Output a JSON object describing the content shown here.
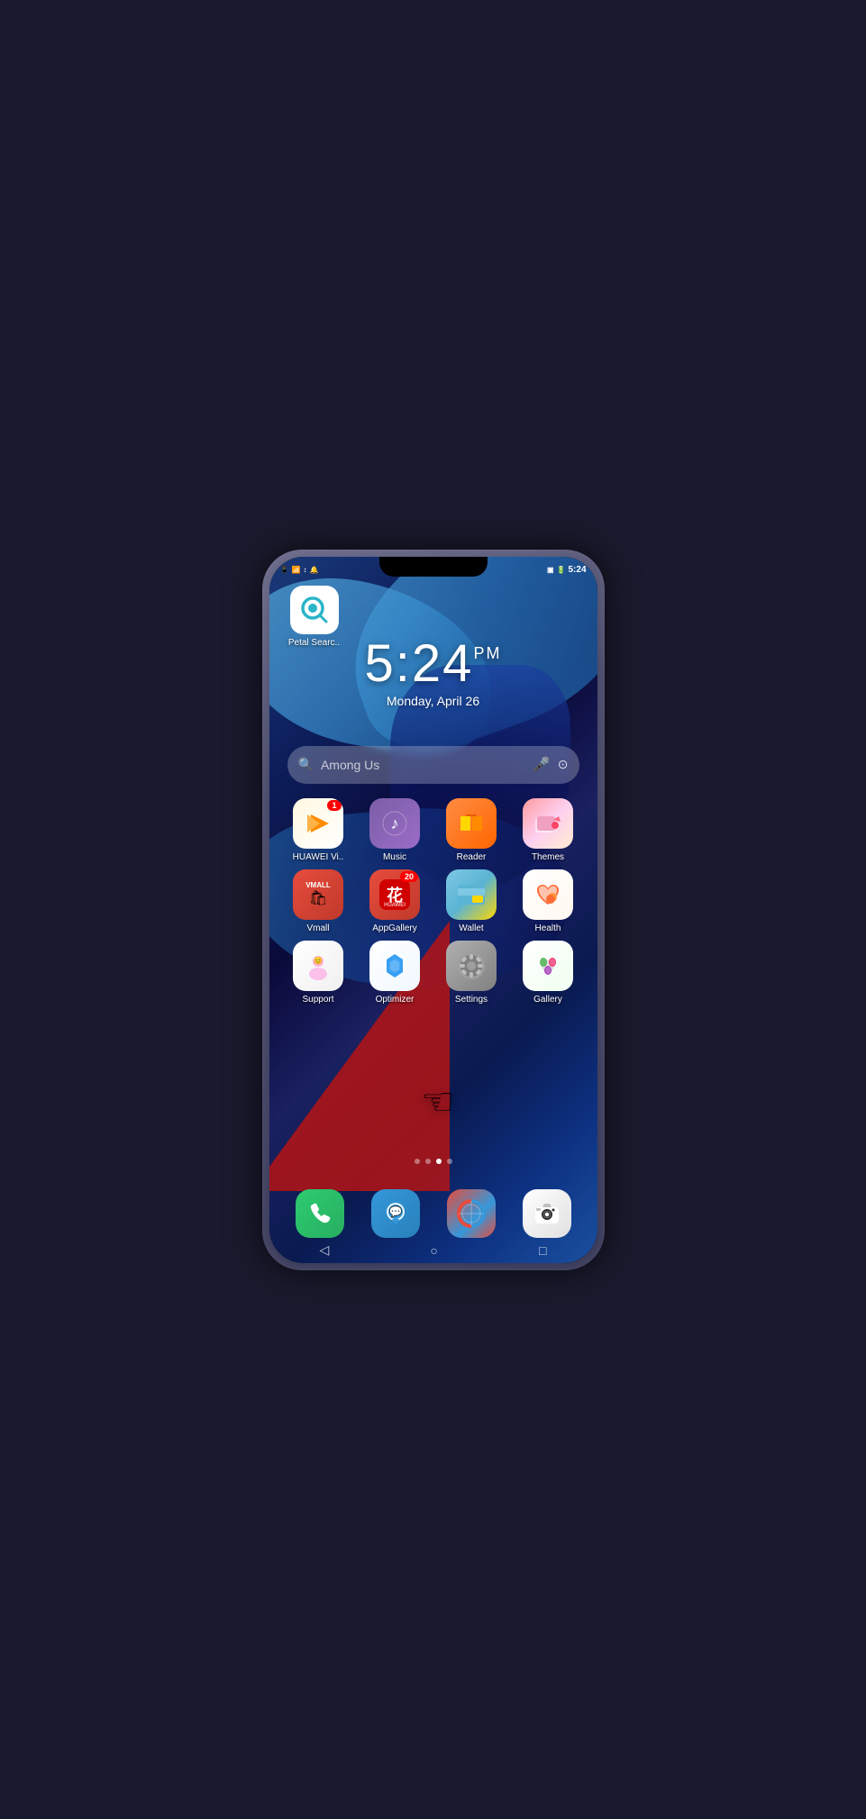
{
  "phone": {
    "status_bar": {
      "time": "5:24",
      "battery_icon": "🔋",
      "signal_icons": "📶"
    },
    "clock": {
      "time": "5:24",
      "period": "PM",
      "date": "Monday, April 26"
    },
    "search": {
      "placeholder": "Among Us",
      "voice_icon": "🎤",
      "scan_icon": "⊙"
    },
    "top_app": {
      "name": "Petal Searc..",
      "icon_char": "Q"
    },
    "apps_row1": [
      {
        "id": "huawei-video",
        "label": "HUAWEI Vi..",
        "badge": "1",
        "icon_class": "icon-huawei-video"
      },
      {
        "id": "music",
        "label": "Music",
        "badge": "",
        "icon_class": "icon-music"
      },
      {
        "id": "reader",
        "label": "Reader",
        "badge": "",
        "icon_class": "icon-reader"
      },
      {
        "id": "themes",
        "label": "Themes",
        "badge": "",
        "icon_class": "icon-themes"
      }
    ],
    "apps_row2": [
      {
        "id": "vmall",
        "label": "Vmall",
        "badge": "",
        "icon_class": "icon-vmall"
      },
      {
        "id": "appgallery",
        "label": "AppGallery",
        "badge": "20",
        "icon_class": "icon-appgallery"
      },
      {
        "id": "wallet",
        "label": "Wallet",
        "badge": "",
        "icon_class": "icon-wallet"
      },
      {
        "id": "health",
        "label": "Health",
        "badge": "",
        "icon_class": "icon-health"
      }
    ],
    "apps_row3": [
      {
        "id": "support",
        "label": "Support",
        "badge": "",
        "icon_class": "icon-support"
      },
      {
        "id": "optimizer",
        "label": "Optimizer",
        "badge": "",
        "icon_class": "icon-optimizer"
      },
      {
        "id": "settings",
        "label": "Settings",
        "badge": "",
        "icon_class": "icon-settings"
      },
      {
        "id": "gallery",
        "label": "Gallery",
        "badge": "",
        "icon_class": "icon-gallery"
      }
    ],
    "dock": [
      {
        "id": "phone",
        "icon_class": "icon-phone"
      },
      {
        "id": "messages",
        "icon_class": "icon-messages"
      },
      {
        "id": "browser",
        "icon_class": "icon-browser"
      },
      {
        "id": "camera",
        "icon_class": "icon-camera"
      }
    ],
    "nav": {
      "back": "◁",
      "home": "○",
      "recent": "□"
    },
    "dots": [
      false,
      false,
      true,
      false
    ]
  }
}
